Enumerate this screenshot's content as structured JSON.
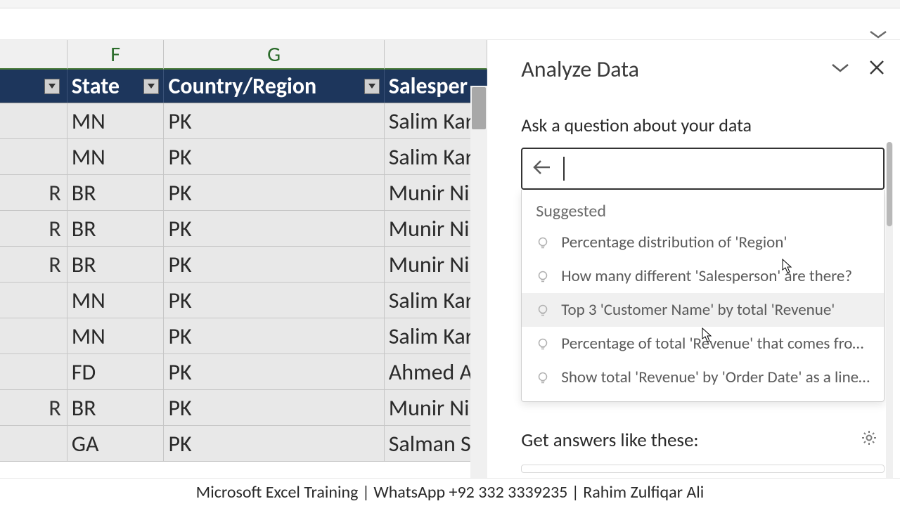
{
  "columns": {
    "f_letter": "F",
    "g_letter": "G"
  },
  "headers": {
    "state": "State",
    "country": "Country/Region",
    "salesperson": "Salesper"
  },
  "rows": [
    {
      "e": "",
      "state": "MN",
      "country": "PK",
      "sales": "Salim Kar"
    },
    {
      "e": "",
      "state": "MN",
      "country": "PK",
      "sales": "Salim Kar"
    },
    {
      "e": "R",
      "state": "BR",
      "country": "PK",
      "sales": "Munir Ni"
    },
    {
      "e": "R",
      "state": "BR",
      "country": "PK",
      "sales": "Munir Ni"
    },
    {
      "e": "R",
      "state": "BR",
      "country": "PK",
      "sales": "Munir Ni"
    },
    {
      "e": "",
      "state": "MN",
      "country": "PK",
      "sales": "Salim Kar"
    },
    {
      "e": "",
      "state": "MN",
      "country": "PK",
      "sales": "Salim Kar"
    },
    {
      "e": "",
      "state": "FD",
      "country": "PK",
      "sales": "Ahmed A"
    },
    {
      "e": "R",
      "state": "BR",
      "country": "PK",
      "sales": "Munir Ni"
    },
    {
      "e": "",
      "state": "GA",
      "country": "PK",
      "sales": "Salman S"
    }
  ],
  "panel": {
    "title": "Analyze Data",
    "ask_label": "Ask a question about your data",
    "suggested_label": "Suggested",
    "suggestions": [
      "Percentage distribution of 'Region'",
      "How many different 'Salesperson' are there?",
      "Top 3 'Customer Name' by total 'Revenue'",
      "Percentage of total 'Revenue' that comes fro…",
      "Show total 'Revenue' by 'Order Date' as a line…"
    ],
    "get_answers": "Get answers like these:"
  },
  "footer": "Microsoft Excel Training | WhatsApp +92 332 3339235 | Rahim Zulfiqar Ali"
}
